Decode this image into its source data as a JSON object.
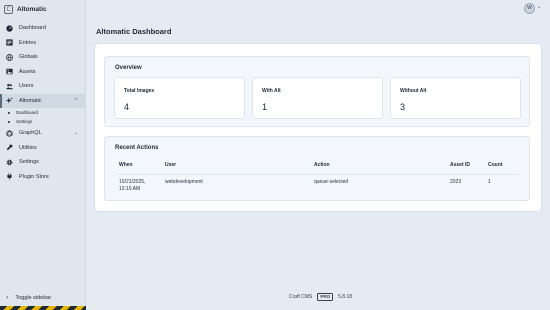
{
  "site": {
    "badge": "C",
    "name": "Altomatic"
  },
  "nav": [
    {
      "label": "Dashboard",
      "icon": "dashboard-icon"
    },
    {
      "label": "Entries",
      "icon": "entries-icon"
    },
    {
      "label": "Globals",
      "icon": "globe-icon"
    },
    {
      "label": "Assets",
      "icon": "image-icon"
    },
    {
      "label": "Users",
      "icon": "users-icon"
    },
    {
      "label": "Altomatic",
      "icon": "sparkle-icon",
      "active": true,
      "chevron": "^"
    },
    {
      "label": "GraphQL",
      "icon": "graphql-icon",
      "chevron": "⌄"
    },
    {
      "label": "Utilities",
      "icon": "wrench-icon"
    },
    {
      "label": "Settings",
      "icon": "gear-icon"
    },
    {
      "label": "Plugin Store",
      "icon": "plug-icon"
    }
  ],
  "subnav": [
    "Dashboard",
    "Settings"
  ],
  "toggle_sidebar": {
    "arrow": "‹",
    "label": "Toggle sidebar"
  },
  "user": {
    "initial": "W",
    "chevron": "⌄"
  },
  "page_title": "Altomatic Dashboard",
  "overview": {
    "title": "Overview",
    "stats": [
      {
        "label": "Total Images",
        "value": "4"
      },
      {
        "label": "With Alt",
        "value": "1"
      },
      {
        "label": "Without Alt",
        "value": "3"
      }
    ]
  },
  "recent": {
    "title": "Recent Actions",
    "columns": [
      "When",
      "User",
      "Action",
      "Asset ID",
      "Count"
    ],
    "rows": [
      {
        "when_date": "10/21/2025,",
        "when_time": "12:10 AM",
        "user": "webdevelopment",
        "action": "queue-selected",
        "asset_id": "2023",
        "count": "1"
      }
    ]
  },
  "footer": {
    "cms": "Craft CMS",
    "edition": "PRO",
    "version": "5.8.18"
  }
}
